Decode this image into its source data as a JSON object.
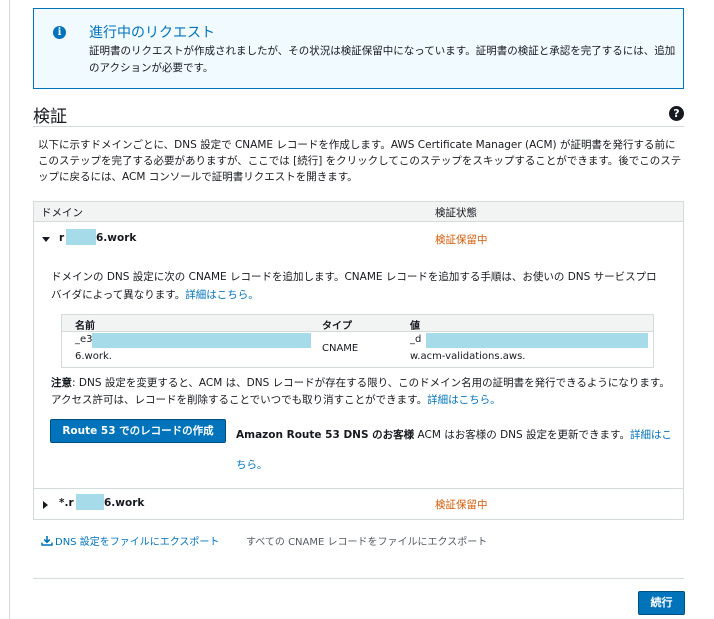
{
  "banner": {
    "title": "進行中のリクエスト",
    "message": "証明書のリクエストが作成されましたが、その状況は検証保留中になっています。証明書の検証と承認を完了するには、追加のアクションが必要です。"
  },
  "section": {
    "title": "検証",
    "description": "以下に示すドメインごとに、DNS 設定で CNAME レコードを作成します。AWS Certificate Manager (ACM) が証明書を発行する前にこのステップを完了する必要がありますが、ここでは [続行] をクリックしてこのステップをスキップすることができます。後でこのステップに戻るには、ACM コンソールで証明書リクエストを開きます。"
  },
  "table": {
    "headers": [
      "ドメイン",
      "検証状態"
    ],
    "domains": [
      {
        "prefix": "r",
        "suffix": "6.work",
        "status": "検証保留中",
        "instruction": "ドメインの DNS 設定に次の CNAME レコードを追加します。CNAME レコードを追加する手順は、お使いの DNS サービスプロバイダによって異なります。",
        "instruction_link": "詳細はこちら。",
        "record": {
          "headers": [
            "名前",
            "タイプ",
            "値"
          ],
          "name_line1": "_e3",
          "name_line2": "6.work.",
          "type": "CNAME",
          "value_line1": "_d",
          "value_line2": "w.acm-validations.aws."
        },
        "note_label": "注意",
        "note_text": ": DNS 設定を変更すると、ACM は、DNS レコードが存在する限り、このドメイン名用の証明書を発行できるようになります。アクセス許可は、レコードを削除することでいつでも取り消すことができます。",
        "note_link": "詳細はこちら。",
        "route53_button": "Route 53 でのレコードの作成",
        "route53_bold": "Amazon Route 53 DNS のお客様",
        "route53_text": " ACM はお客様の DNS 設定を更新できます。",
        "route53_link": "詳細はこちら。"
      },
      {
        "prefix": "*.r",
        "suffix": "6.work",
        "status": "検証保留中"
      }
    ]
  },
  "export": {
    "dns_link": "DNS 設定をファイルにエクスポート",
    "cname_text": "すべての CNAME レコードをファイルにエクスポート"
  },
  "footer": {
    "continue_label": "続行"
  },
  "colors": {
    "accent": "#0073bb",
    "pending": "#d45b07",
    "banner_bg": "#f1faff",
    "redaction": "#a6dcea"
  }
}
